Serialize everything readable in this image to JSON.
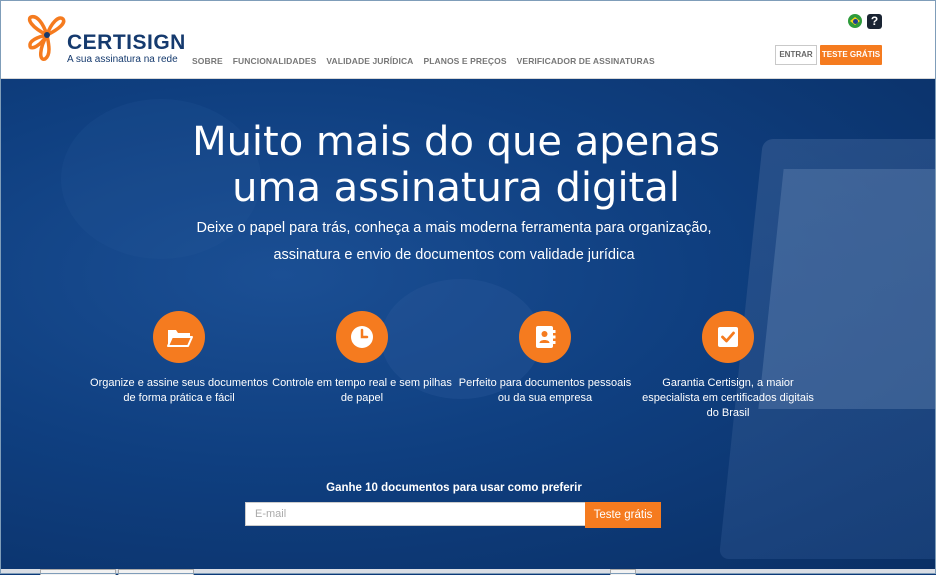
{
  "brand": {
    "name": "CERTISIGN",
    "tagline": "A sua assinatura na rede",
    "orange": "#f57b1f",
    "navy": "#153a6e"
  },
  "nav": {
    "items": [
      "SOBRE",
      "FUNCIONALIDADES",
      "VALIDADE JURÍDICA",
      "PLANOS E PREÇOS",
      "VERIFICADOR DE ASSINATURAS"
    ]
  },
  "header_actions": {
    "language_icon": "brazil-flag-icon",
    "help_label": "?",
    "login_label": "ENTRAR",
    "trial_label": "TESTE GRÁTIS"
  },
  "hero": {
    "title_line1": "Muito mais do que apenas",
    "title_line2": "uma assinatura digital",
    "subtitle_line1": "Deixe o papel para trás, conheça a mais moderna ferramenta para organização,",
    "subtitle_line2": "assinatura e envio de documentos com validade jurídica",
    "background": "#0f3f80"
  },
  "features": [
    {
      "icon": "folder-icon",
      "text": "Organize e assine seus documentos de forma prática e fácil"
    },
    {
      "icon": "clock-icon",
      "text": "Controle em tempo real e sem pilhas de papel"
    },
    {
      "icon": "contact-book-icon",
      "text": "Perfeito para documentos pessoais ou da sua empresa"
    },
    {
      "icon": "checkbox-icon",
      "text": "Garantia Certisign, a maior especialista em certificados digitais do Brasil"
    }
  ],
  "cta": {
    "label": "Ganhe 10 documentos para usar como preferir",
    "email_placeholder": "E-mail",
    "email_value": "",
    "button_label": "Teste grátis"
  }
}
